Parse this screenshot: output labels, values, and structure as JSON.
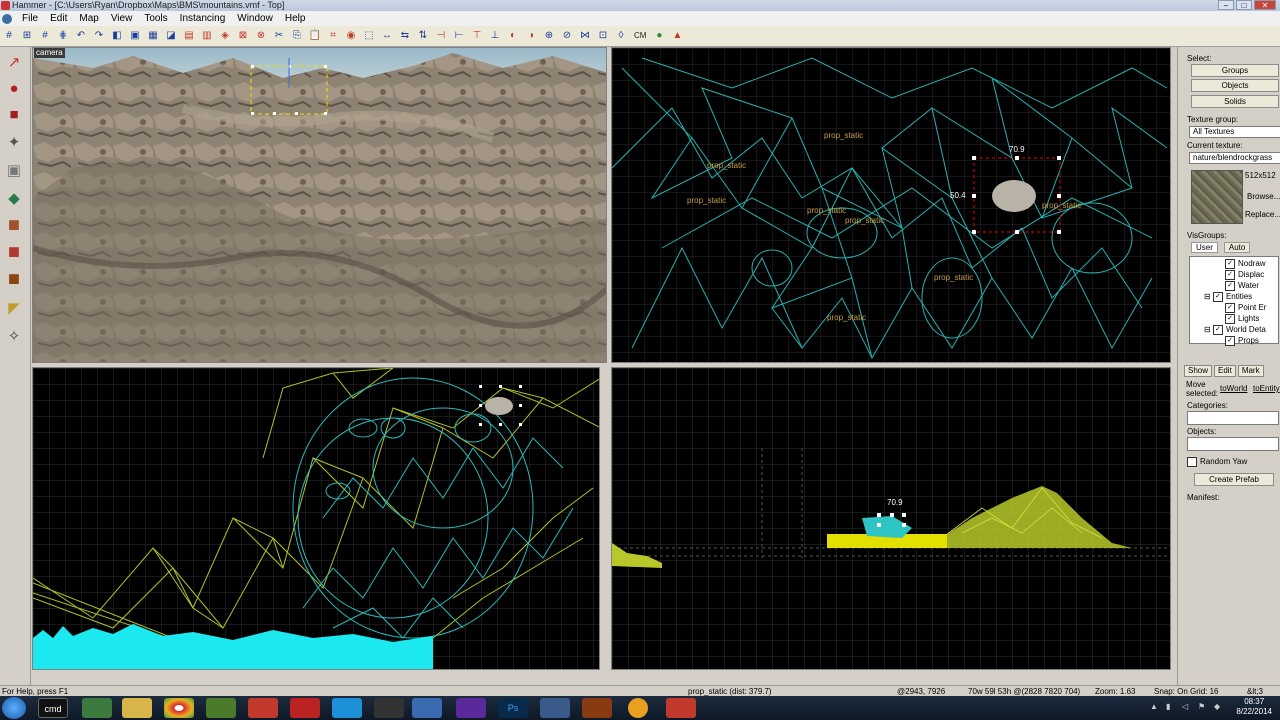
{
  "window": {
    "title": "Hammer - [C:\\Users\\Ryan\\Dropbox\\Maps\\BMS\\mountains.vmf - Top]",
    "min": "–",
    "max": "□",
    "close": "✕"
  },
  "menu": [
    "File",
    "Edit",
    "Map",
    "View",
    "Tools",
    "Instancing",
    "Window",
    "Help"
  ],
  "toolbar": {
    "cm_label": "CM"
  },
  "viewports": {
    "camera_label": "camera",
    "top_labels": [
      "prop_static",
      "prop_static",
      "prop_static",
      "prop_static",
      "prop_static",
      "prop_static",
      "prop_static",
      "prop_static"
    ],
    "top_dims": [
      "70.9",
      "50.4"
    ],
    "side_dim": "70.9"
  },
  "right_panel": {
    "select_label": "Select:",
    "groups": "Groups",
    "objects": "Objects",
    "solids": "Solids",
    "texture_group_label": "Texture group:",
    "texture_group_value": "All Textures",
    "current_texture_label": "Current texture:",
    "current_texture_value": "nature/blendrockgrass",
    "texture_size": "512x512",
    "browse": "Browse...",
    "replace": "Replace...",
    "visgroups_label": "VisGroups:",
    "vis_tabs": [
      "User",
      "Auto"
    ],
    "visgroups": [
      {
        "label": "Nodraw",
        "indent": 2,
        "expander": ""
      },
      {
        "label": "Displac",
        "indent": 2,
        "expander": ""
      },
      {
        "label": "Water",
        "indent": 2,
        "expander": ""
      },
      {
        "label": "Entities",
        "indent": 1,
        "expander": "⊟"
      },
      {
        "label": "Point Er",
        "indent": 2,
        "expander": ""
      },
      {
        "label": "Lights",
        "indent": 2,
        "expander": ""
      },
      {
        "label": "World Deta",
        "indent": 1,
        "expander": "⊟"
      },
      {
        "label": "Props",
        "indent": 2,
        "expander": ""
      }
    ],
    "mini_tabs": [
      "Show",
      "Edit",
      "Mark"
    ],
    "move_selected_label": "Move selected:",
    "to_world": "toWorld",
    "to_entity": "toEntity",
    "categories_label": "Categories:",
    "objects_label": "Objects:",
    "random_yaw": "Random Yaw",
    "create_prefab": "Create Prefab",
    "manifest_label": "Manifest:"
  },
  "status": {
    "help": "For Help, press F1",
    "selection": "prop_static  (dist: 379.7)",
    "coords": "@2943, 7926",
    "size": "70w 59l 53h @(2828 7820 704)",
    "zoom": "Zoom: 1.63",
    "snap": "Snap: On Grid: 16",
    "extra": "&lt;3"
  },
  "taskbar": {
    "time": "08:37",
    "date": "8/22/2014",
    "apps": [
      "cmd",
      "",
      "",
      "",
      "",
      "",
      "",
      "",
      "",
      "",
      "Ps",
      "",
      "",
      "",
      "",
      ""
    ]
  }
}
